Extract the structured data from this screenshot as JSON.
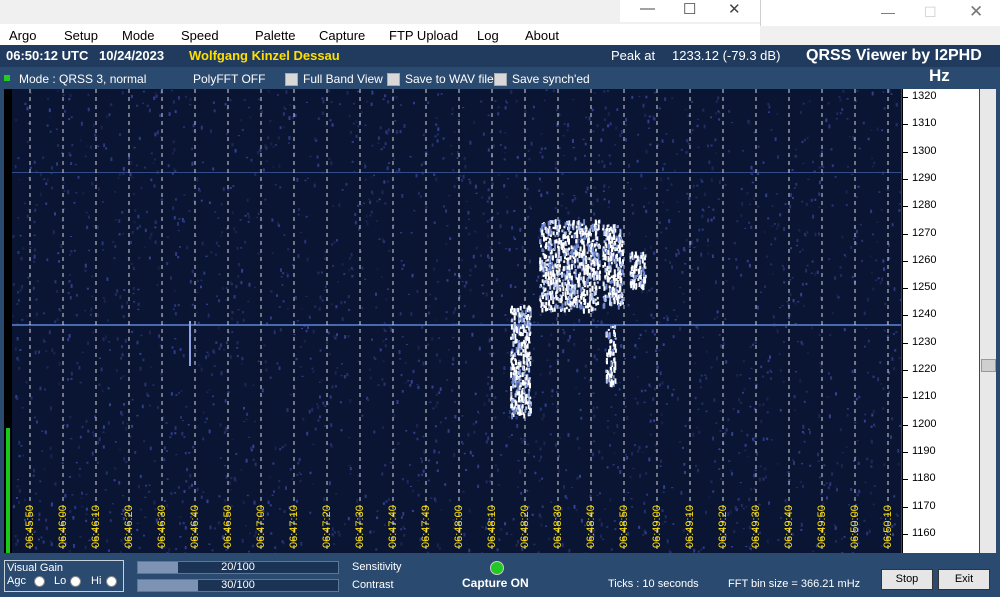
{
  "menu": [
    "Argo",
    "Setup",
    "Mode",
    "Speed",
    "Palette",
    "Capture",
    "FTP Upload",
    "Log",
    "About"
  ],
  "header": {
    "time_utc": "06:50:12 UTC",
    "date": "10/24/2023",
    "callsign": "Wolfgang Kinzel Dessau",
    "peak_label": "Peak at",
    "peak_value": "1233.12 (-79.3 dB)",
    "brand": "QRSS Viewer by I2PHD",
    "unit": "Hz"
  },
  "options": {
    "mode": "Mode : QRSS 3, normal",
    "polyfft": "PolyFFT OFF",
    "full_band": "Full Band View",
    "save_wav": "Save to WAV file",
    "save_synch": "Save synch'ed"
  },
  "freq_scale": [
    "1320",
    "1310",
    "1300",
    "1290",
    "1280",
    "1270",
    "1260",
    "1250",
    "1240",
    "1230",
    "1220",
    "1210",
    "1200",
    "1190",
    "1180",
    "1170",
    "1160"
  ],
  "time_labels": [
    "06:45:50",
    "06:46:00",
    "06:46:10",
    "06:46:20",
    "06:46:30",
    "06:46:40",
    "06:46:50",
    "06:47:00",
    "06:47:10",
    "06:47:20",
    "06:47:30",
    "06:47:40",
    "06:47:49",
    "06:48:00",
    "06:48:10",
    "06:48:20",
    "06:48:30",
    "06:48:40",
    "06:48:50",
    "06:49:00",
    "06:49:10",
    "06:49:20",
    "06:49:30",
    "06:49:40",
    "06:49:50",
    "06:50:00",
    "06:50:10"
  ],
  "bottom": {
    "visual_gain": "Visual Gain",
    "agc": "Agc",
    "lo": "Lo",
    "hi": "Hi",
    "sensitivity_value": "20/100",
    "sensitivity_fraction": 0.2,
    "sensitivity_label": "Sensitivity",
    "contrast_value": "30/100",
    "contrast_fraction": 0.3,
    "contrast_label": "Contrast",
    "capture_status": "Capture ON",
    "ticks": "Ticks   : 10 seconds",
    "fft_bin": "FFT bin size = 366.21 mHz",
    "stop": "Stop",
    "exit": "Exit"
  },
  "colors": {
    "background": "#0a1533",
    "frame": "#2b4a6f",
    "label_yellow": "#ffe000",
    "signal": "#ffffff"
  }
}
